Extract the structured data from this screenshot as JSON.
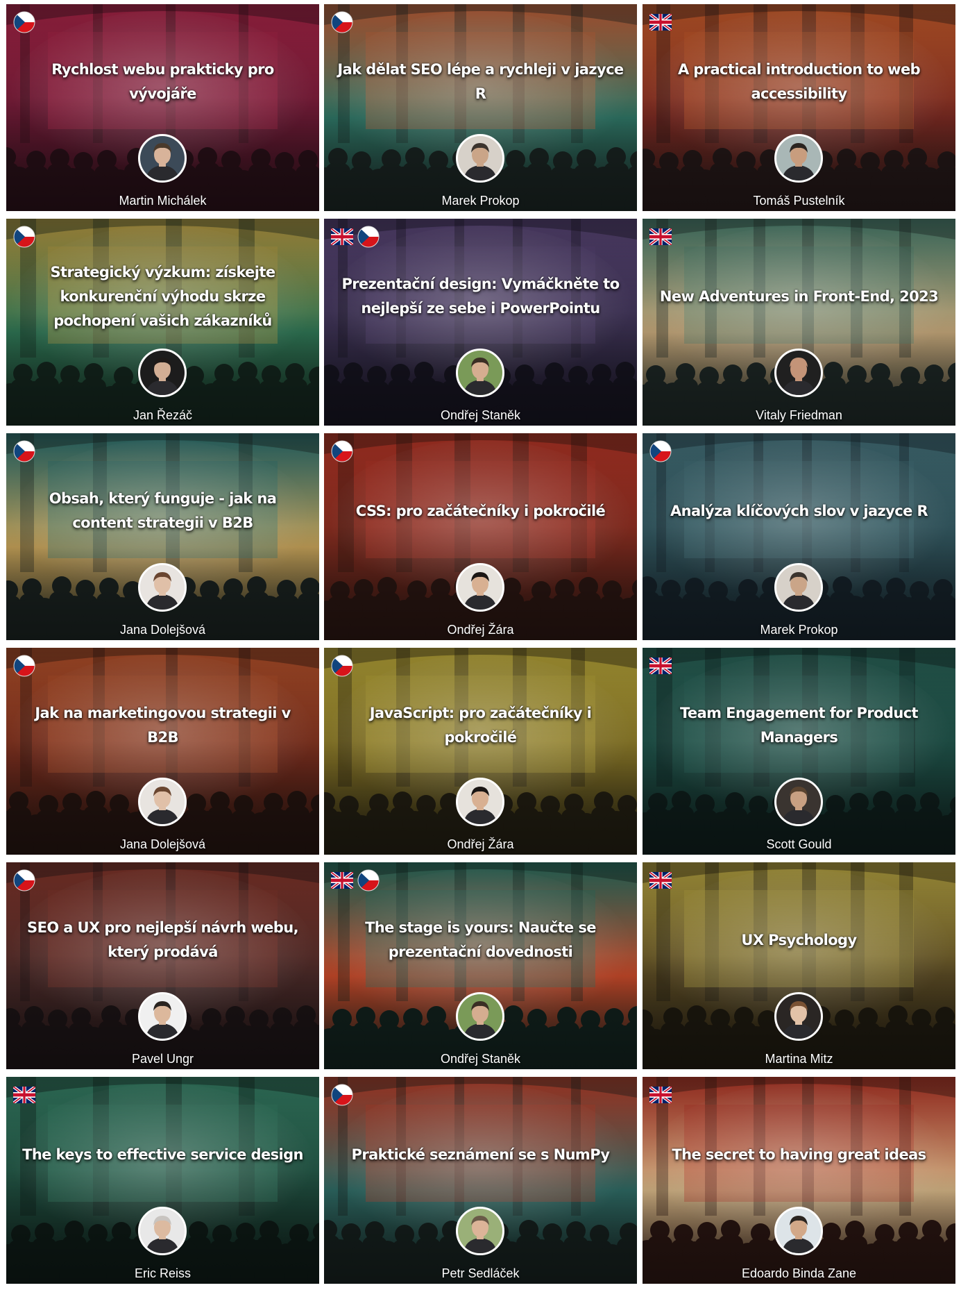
{
  "talks": [
    {
      "title": "Rychlost webu prakticky pro vývojáře",
      "speaker": "Martin Michálek",
      "flags": [
        "cz"
      ],
      "colors": [
        "#b8284e",
        "#6a1a34",
        "#281018"
      ],
      "avatar": {
        "skin": "#d8b39a",
        "hair": "#4a3a2c",
        "bg": "#3c4a58"
      }
    },
    {
      "title": "Jak dělat SEO lépe a rychleji v jazyce R",
      "speaker": "Marek Prokop",
      "flags": [
        "cz"
      ],
      "colors": [
        "#d4693e",
        "#2f7666",
        "#1a2422"
      ],
      "avatar": {
        "skin": "#caa588",
        "hair": "#3b342e",
        "bg": "#d7d1c9"
      }
    },
    {
      "title": "A practical introduction to web accessibility",
      "speaker": "Tomáš Pustelník",
      "flags": [
        "uk"
      ],
      "colors": [
        "#d8632e",
        "#7a2a22",
        "#241818"
      ],
      "avatar": {
        "skin": "#c89d7e",
        "hair": "#2a2420",
        "bg": "#a9b7b6"
      }
    },
    {
      "title": "Strategický výzkum: získejte konkurenční výhodu skrze pochopení vašich zákazníků",
      "speaker": "Jan Řezáč",
      "flags": [
        "cz"
      ],
      "colors": [
        "#c9a848",
        "#2f7655",
        "#14261e"
      ],
      "avatar": {
        "skin": "#d2ae94",
        "hair": "#1e1a18",
        "bg": "#1c1c1c"
      }
    },
    {
      "title": "Prezentační design: Vymáčkněte to nejlepší ze sebe i PowerPointu",
      "speaker": "Ondřej Staněk",
      "flags": [
        "uk",
        "cz"
      ],
      "colors": [
        "#5f4a7e",
        "#3a3050",
        "#161420"
      ],
      "avatar": {
        "skin": "#d5ad90",
        "hair": "#3a2e24",
        "bg": "#7a9a58"
      }
    },
    {
      "title": "New Adventures in Front-End, 2023",
      "speaker": "Vitaly Friedman",
      "flags": [
        "uk"
      ],
      "colors": [
        "#4f8a78",
        "#c8aa7c",
        "#1e2826"
      ],
      "avatar": {
        "skin": "#c49478",
        "hair": "#c49478",
        "bg": "#202020"
      }
    },
    {
      "title": "Obsah, který funguje - jak na content strategii v B2B",
      "speaker": "Jana Dolejšová",
      "flags": [
        "cz"
      ],
      "colors": [
        "#2e7a7a",
        "#c8a45a",
        "#1a2220"
      ],
      "avatar": {
        "skin": "#e0c0a8",
        "hair": "#6a4630",
        "bg": "#e8e4e0"
      }
    },
    {
      "title": "CSS: pro začátečníky i pokročilé",
      "speaker": "Ondřej Žára",
      "flags": [
        "cz"
      ],
      "colors": [
        "#c43a2a",
        "#7a2a1e",
        "#2a1612"
      ],
      "avatar": {
        "skin": "#d8b092",
        "hair": "#1a1614",
        "bg": "#e6e2dc"
      }
    },
    {
      "title": "Analýza klíčových slov v jazyce R",
      "speaker": "Marek Prokop",
      "flags": [
        "cz"
      ],
      "colors": [
        "#4a7a84",
        "#2e5058",
        "#16222a"
      ],
      "avatar": {
        "skin": "#caa588",
        "hair": "#3b342e",
        "bg": "#d7d1c9"
      }
    },
    {
      "title": "Jak na marketingovou strategii v B2B",
      "speaker": "Jana Dolejšová",
      "flags": [
        "cz"
      ],
      "colors": [
        "#c4582e",
        "#6e2a1c",
        "#241410"
      ],
      "avatar": {
        "skin": "#e0c0a8",
        "hair": "#6a4630",
        "bg": "#e8e4e0"
      }
    },
    {
      "title": "JavaScript: pro začátečníky i pokročilé",
      "speaker": "Ondřej Žára",
      "flags": [
        "cz"
      ],
      "colors": [
        "#c8b43e",
        "#7a6a24",
        "#221e12"
      ],
      "avatar": {
        "skin": "#d8b092",
        "hair": "#1a1614",
        "bg": "#e6e2dc"
      }
    },
    {
      "title": "Team Engagement for Product Managers",
      "speaker": "Scott Gould",
      "flags": [
        "uk"
      ],
      "colors": [
        "#2c6a5e",
        "#1c4a42",
        "#0f1e1c"
      ],
      "avatar": {
        "skin": "#c8a082",
        "hair": "#5a4430",
        "bg": "#3a3430"
      }
    },
    {
      "title": "SEO a UX pro nejlepší návrh webu, který prodává",
      "speaker": "Pavel Ungr",
      "flags": [
        "cz"
      ],
      "colors": [
        "#8e3a2e",
        "#4a2a28",
        "#1c1416"
      ],
      "avatar": {
        "skin": "#dcb89c",
        "hair": "#2a2420",
        "bg": "#f0f0f0"
      }
    },
    {
      "title": "The stage is yours: Naučte se prezentační dovednosti",
      "speaker": "Ondřej Staněk",
      "flags": [
        "uk",
        "cz"
      ],
      "colors": [
        "#2e7a6a",
        "#c84a2a",
        "#12221e"
      ],
      "avatar": {
        "skin": "#d5ad90",
        "hair": "#3a2e24",
        "bg": "#7a9a58"
      }
    },
    {
      "title": "UX Psychology",
      "speaker": "Martina Mitz",
      "flags": [
        "uk"
      ],
      "colors": [
        "#c8b448",
        "#5a4a24",
        "#1e1a10"
      ],
      "avatar": {
        "skin": "#e2c2a8",
        "hair": "#7a5234",
        "bg": "#2a2624"
      }
    },
    {
      "title": "The keys to effective service design",
      "speaker": "Eric Reiss",
      "flags": [
        "uk"
      ],
      "colors": [
        "#3a8a6e",
        "#1e4a3c",
        "#0e1a16"
      ],
      "avatar": {
        "skin": "#dcbaa0",
        "hair": "#c8c4c0",
        "bg": "#e8e8e8"
      }
    },
    {
      "title": "Praktické seznámení se s NumPy",
      "speaker": "Petr Sedláček",
      "flags": [
        "cz"
      ],
      "colors": [
        "#c8442e",
        "#2e6a64",
        "#16201e"
      ],
      "avatar": {
        "skin": "#dcb498",
        "hair": "#6a5a48",
        "bg": "#9ab078"
      }
    },
    {
      "title": "The secret to having great ideas",
      "speaker": "Edoardo Binda Zane",
      "flags": [
        "uk"
      ],
      "colors": [
        "#c43a2a",
        "#d8b888",
        "#2a1612"
      ],
      "avatar": {
        "skin": "#d2a888",
        "hair": "#2a2420",
        "bg": "#dde4e8"
      }
    }
  ]
}
